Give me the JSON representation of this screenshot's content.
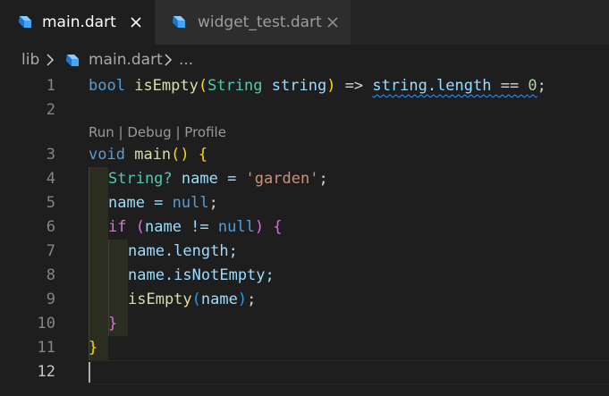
{
  "tabs": [
    {
      "label": "main.dart",
      "active": true,
      "icon": "dart-icon"
    },
    {
      "label": "widget_test.dart",
      "active": false,
      "icon": "dart-icon"
    }
  ],
  "breadcrumb": {
    "items": [
      "lib",
      "main.dart",
      "..."
    ]
  },
  "codelens": {
    "run": "Run",
    "debug": "Debug",
    "profile": "Profile",
    "separator": " | "
  },
  "line_numbers": [
    "1",
    "2",
    "3",
    "4",
    "5",
    "6",
    "7",
    "8",
    "9",
    "10",
    "11",
    "12"
  ],
  "code": {
    "l1": {
      "bool": "bool",
      "fn": "isEmpty",
      "p1": "(",
      "type": "String",
      "param": "string",
      "p2": ")",
      "arrow": " => ",
      "expr": "string.length",
      "op": " == ",
      "zero": "0",
      "semi": ";"
    },
    "l3": {
      "void": "void",
      "fn": "main",
      "parens": "()",
      "brace": "{"
    },
    "l4": {
      "type": "String?",
      "rest": " name = ",
      "str": "'garden'",
      "semi": ";"
    },
    "l5": {
      "lhs": "name = ",
      "null": "null",
      "semi": ";"
    },
    "l6": {
      "if": "if",
      "p1": "(",
      "cond": "name != ",
      "null": "null",
      "p2": ")",
      "brace": "{"
    },
    "l7": {
      "text": "name.length;"
    },
    "l8": {
      "text": "name.isNotEmpty;"
    },
    "l9": {
      "fn": "isEmpty",
      "p1": "(",
      "arg": "name",
      "p2": ")",
      "semi": ";"
    },
    "l10": {
      "brace": "}"
    },
    "l11": {
      "brace": "}"
    }
  },
  "colors": {
    "background": "#1e1e1e",
    "keyword": "#569cd6",
    "control": "#c586c0",
    "function": "#dcdcaa",
    "string": "#ce9178",
    "number": "#b5cea8"
  }
}
